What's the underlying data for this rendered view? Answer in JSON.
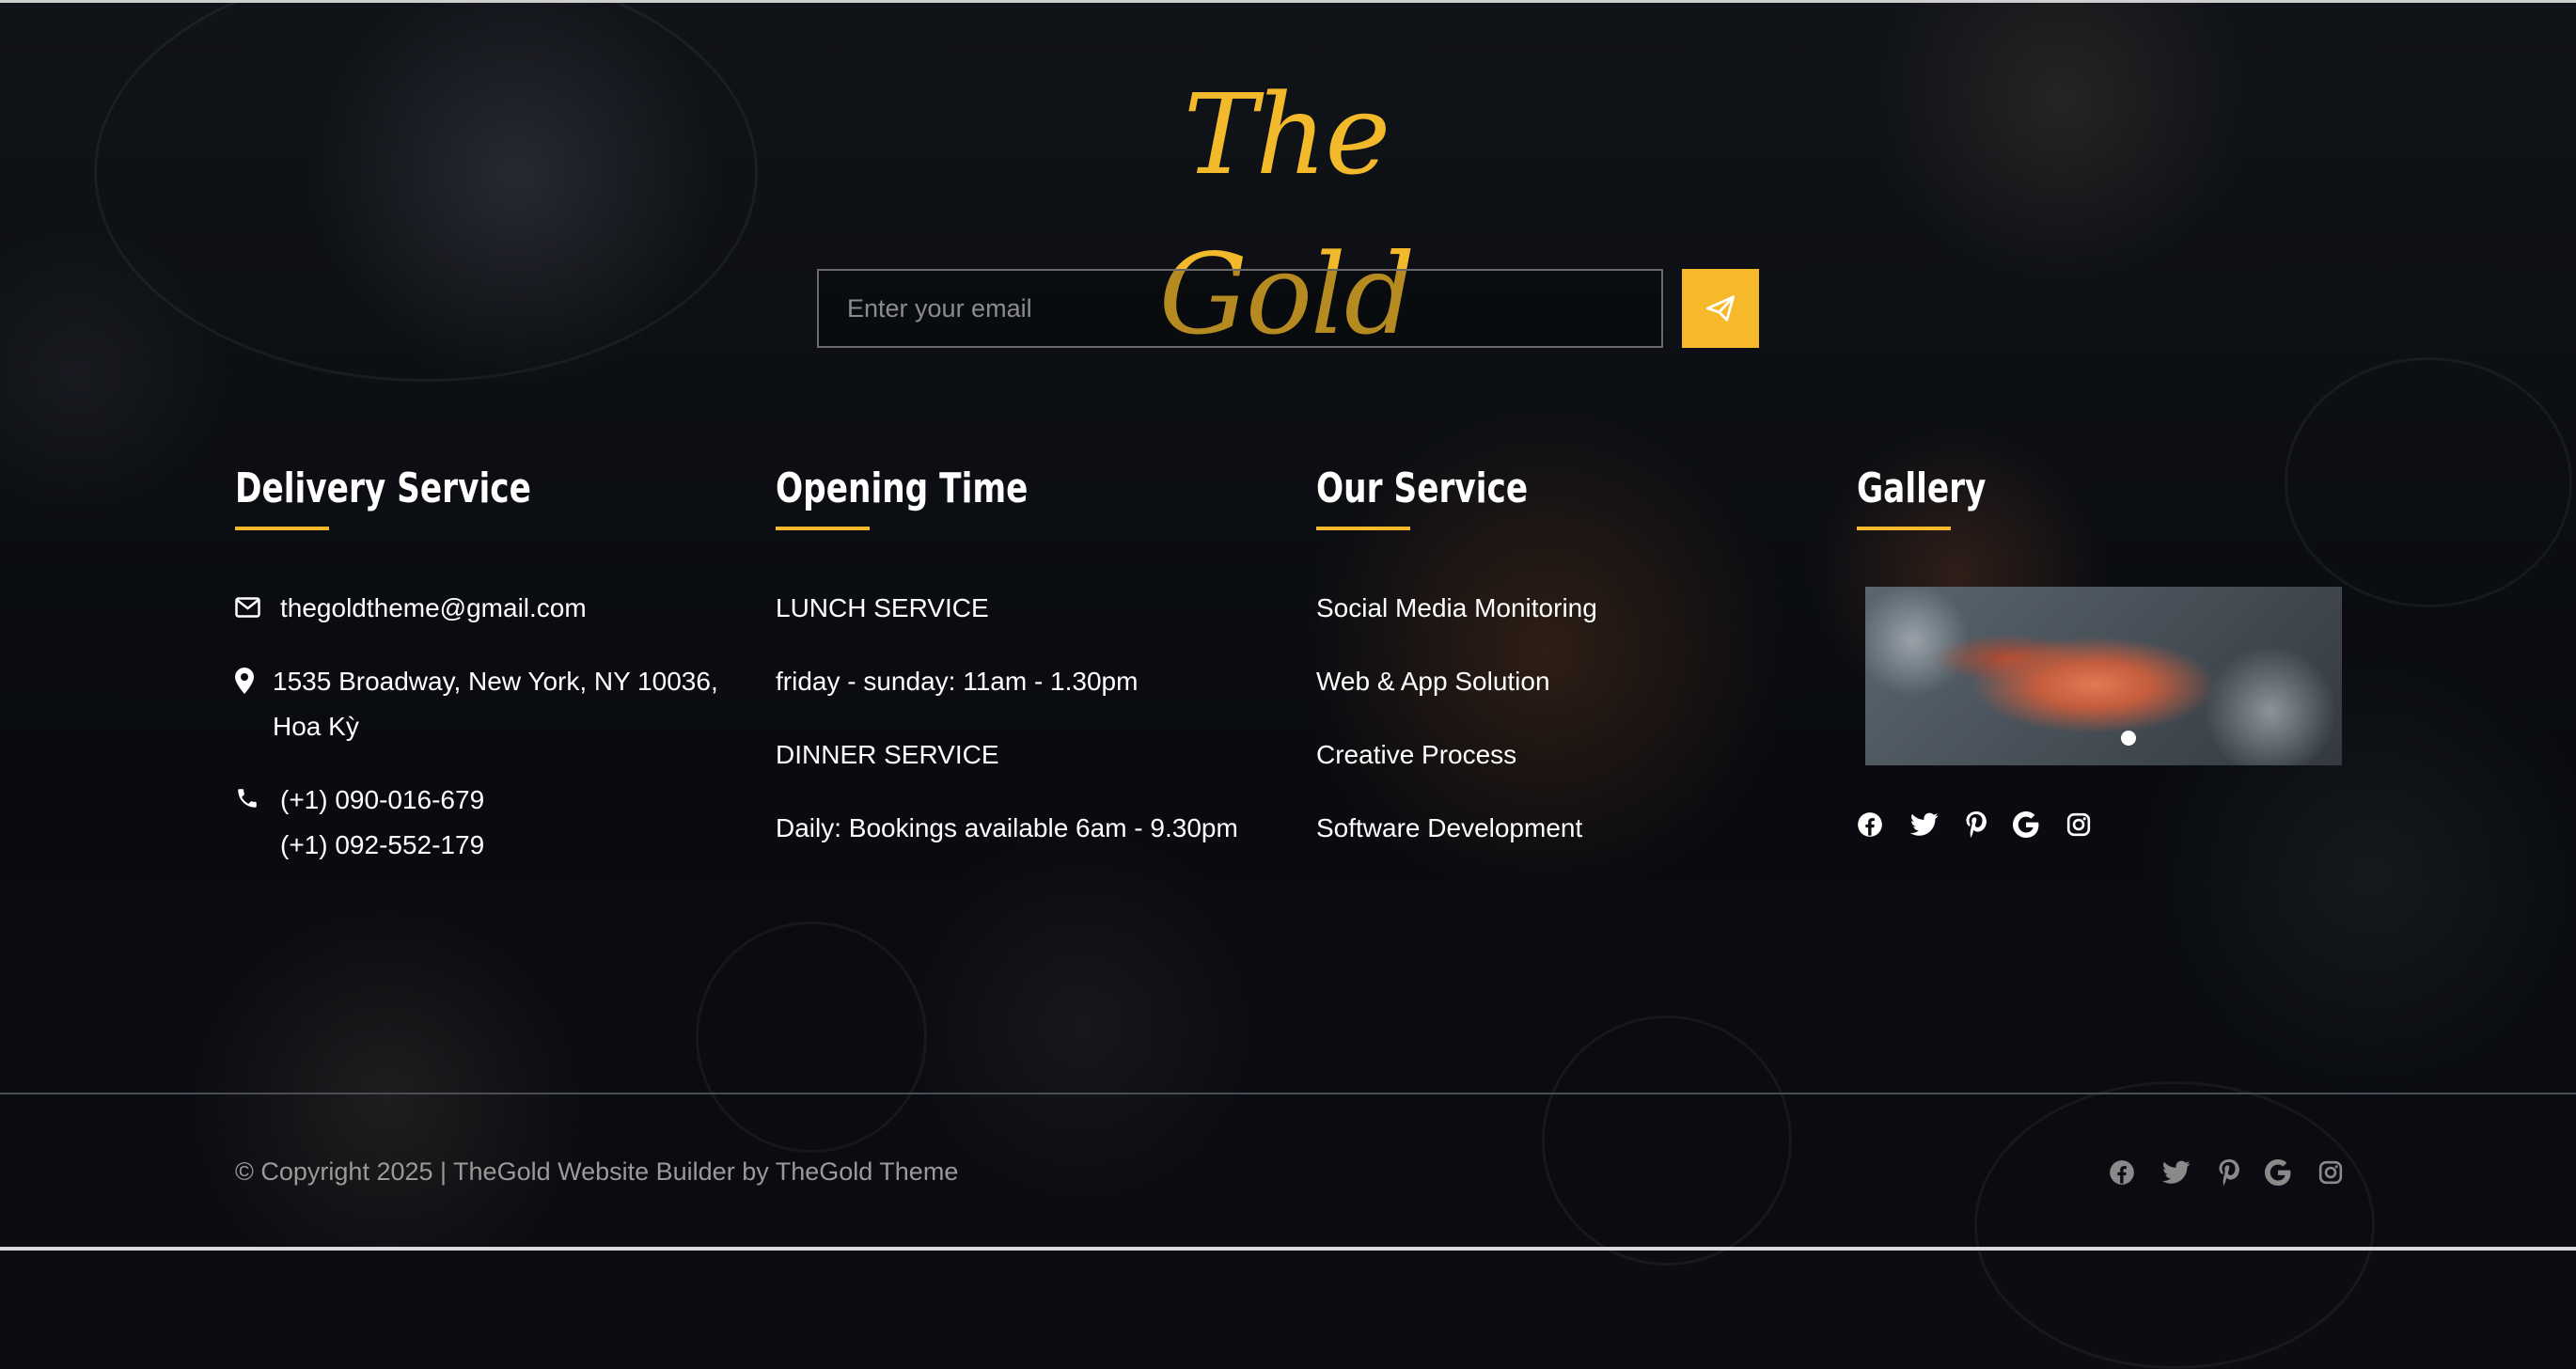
{
  "brand": {
    "logo_text": "The Gold",
    "accent_color": "#f6b92b"
  },
  "newsletter": {
    "placeholder": "Enter your email",
    "submit_icon": "send-icon"
  },
  "delivery": {
    "heading": "Delivery Service",
    "email": "thegoldtheme@gmail.com",
    "address_line1": "1535 Broadway, New York, NY 10036,",
    "address_line2": "Hoa Kỳ",
    "phone1": "(+1) 090-016-679",
    "phone2": "(+1) 092-552-179"
  },
  "opening": {
    "heading": "Opening Time",
    "lines": [
      "LUNCH SERVICE",
      "friday - sunday: 11am - 1.30pm",
      "DINNER SERVICE",
      "Daily: Bookings available 6am - 9.30pm"
    ]
  },
  "service": {
    "heading": "Our Service",
    "items": [
      "Social Media Monitoring",
      "Web & App Solution",
      "Creative Process",
      "Software Development"
    ]
  },
  "gallery": {
    "heading": "Gallery",
    "social_icons": [
      "facebook-icon",
      "twitter-icon",
      "pinterest-icon",
      "google-icon",
      "instagram-icon"
    ]
  },
  "footer": {
    "copyright": "© Copyright 2025 | TheGold Website Builder by TheGold Theme",
    "social_icons": [
      "facebook-icon",
      "twitter-icon",
      "pinterest-icon",
      "google-icon",
      "instagram-icon"
    ]
  }
}
